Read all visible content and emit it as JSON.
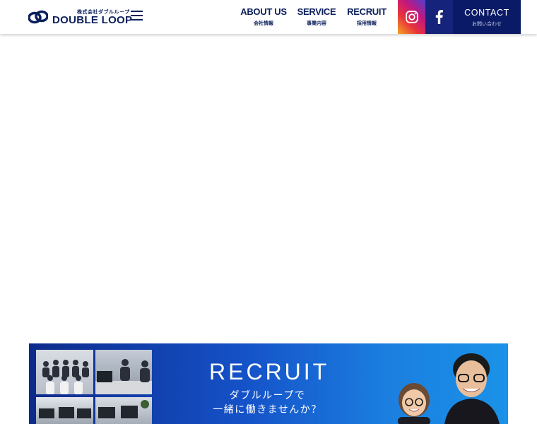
{
  "header": {
    "logo": {
      "sub": "株式会社ダブルループ",
      "main": "DOUBLE LOOP"
    },
    "menu_icon": "hamburger-icon",
    "nav": [
      {
        "en": "ABOUT US",
        "jp": "会社情報"
      },
      {
        "en": "SERVICE",
        "jp": "事業内容"
      },
      {
        "en": "RECRUIT",
        "jp": "採用情報"
      }
    ],
    "sns": [
      {
        "icon": "instagram-icon"
      },
      {
        "icon": "facebook-icon"
      }
    ],
    "contact": {
      "en": "CONTACT",
      "jp": "お問い合わせ"
    }
  },
  "banner": {
    "title": "RECRUIT",
    "sub_line1": "ダブルループで",
    "sub_line2": "一緒に働きませんか？"
  },
  "colors": {
    "brand_navy": "#0b1f5c",
    "contact_bg": "#0b1a66",
    "facebook_bg": "#15247a",
    "banner_start": "#0d2a8a",
    "banner_end": "#1a92e8"
  }
}
